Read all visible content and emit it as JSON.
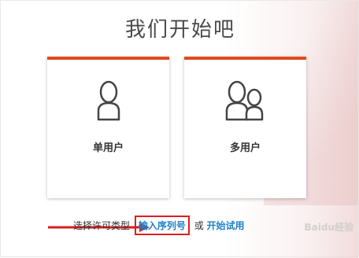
{
  "title": "我们开始吧",
  "cards": {
    "single": {
      "label": "单用户",
      "icon": "user-icon"
    },
    "multi": {
      "label": "多用户",
      "icon": "users-icon"
    }
  },
  "footer": {
    "prefix": "选择许可类型",
    "serial_link": "输入序列号",
    "or_text": "或",
    "trial_link": "开始试用"
  },
  "watermark": "Baidu经验",
  "colors": {
    "card_accent": "#e04a1f",
    "link": "#1f82c8",
    "highlight_box": "#e01e1e"
  }
}
